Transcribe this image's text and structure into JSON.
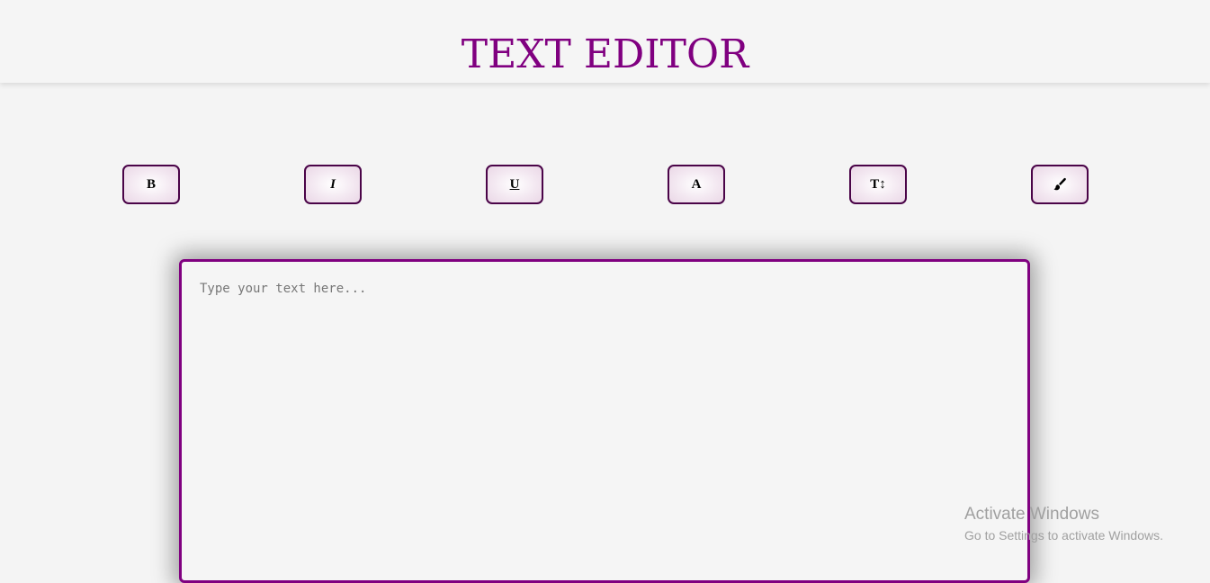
{
  "header": {
    "title": "TEXT EDITOR"
  },
  "toolbar": {
    "buttons": [
      {
        "label": "B",
        "icon": "bold-icon"
      },
      {
        "label": "I",
        "icon": "italic-icon"
      },
      {
        "label": "U",
        "icon": "underline-icon"
      },
      {
        "label": "A",
        "icon": "font-color-icon"
      },
      {
        "label": "T↕",
        "icon": "font-size-icon"
      },
      {
        "label": "",
        "icon": "paintbrush-icon"
      }
    ]
  },
  "editor": {
    "placeholder": "Type your text here...",
    "value": ""
  },
  "watermark": {
    "title": "Activate Windows",
    "subtitle": "Go to Settings to activate Windows."
  },
  "colors": {
    "accent": "#800080",
    "button_border": "#4a0448",
    "background": "#f4f4f4",
    "watermark": "#a0a0a0"
  }
}
